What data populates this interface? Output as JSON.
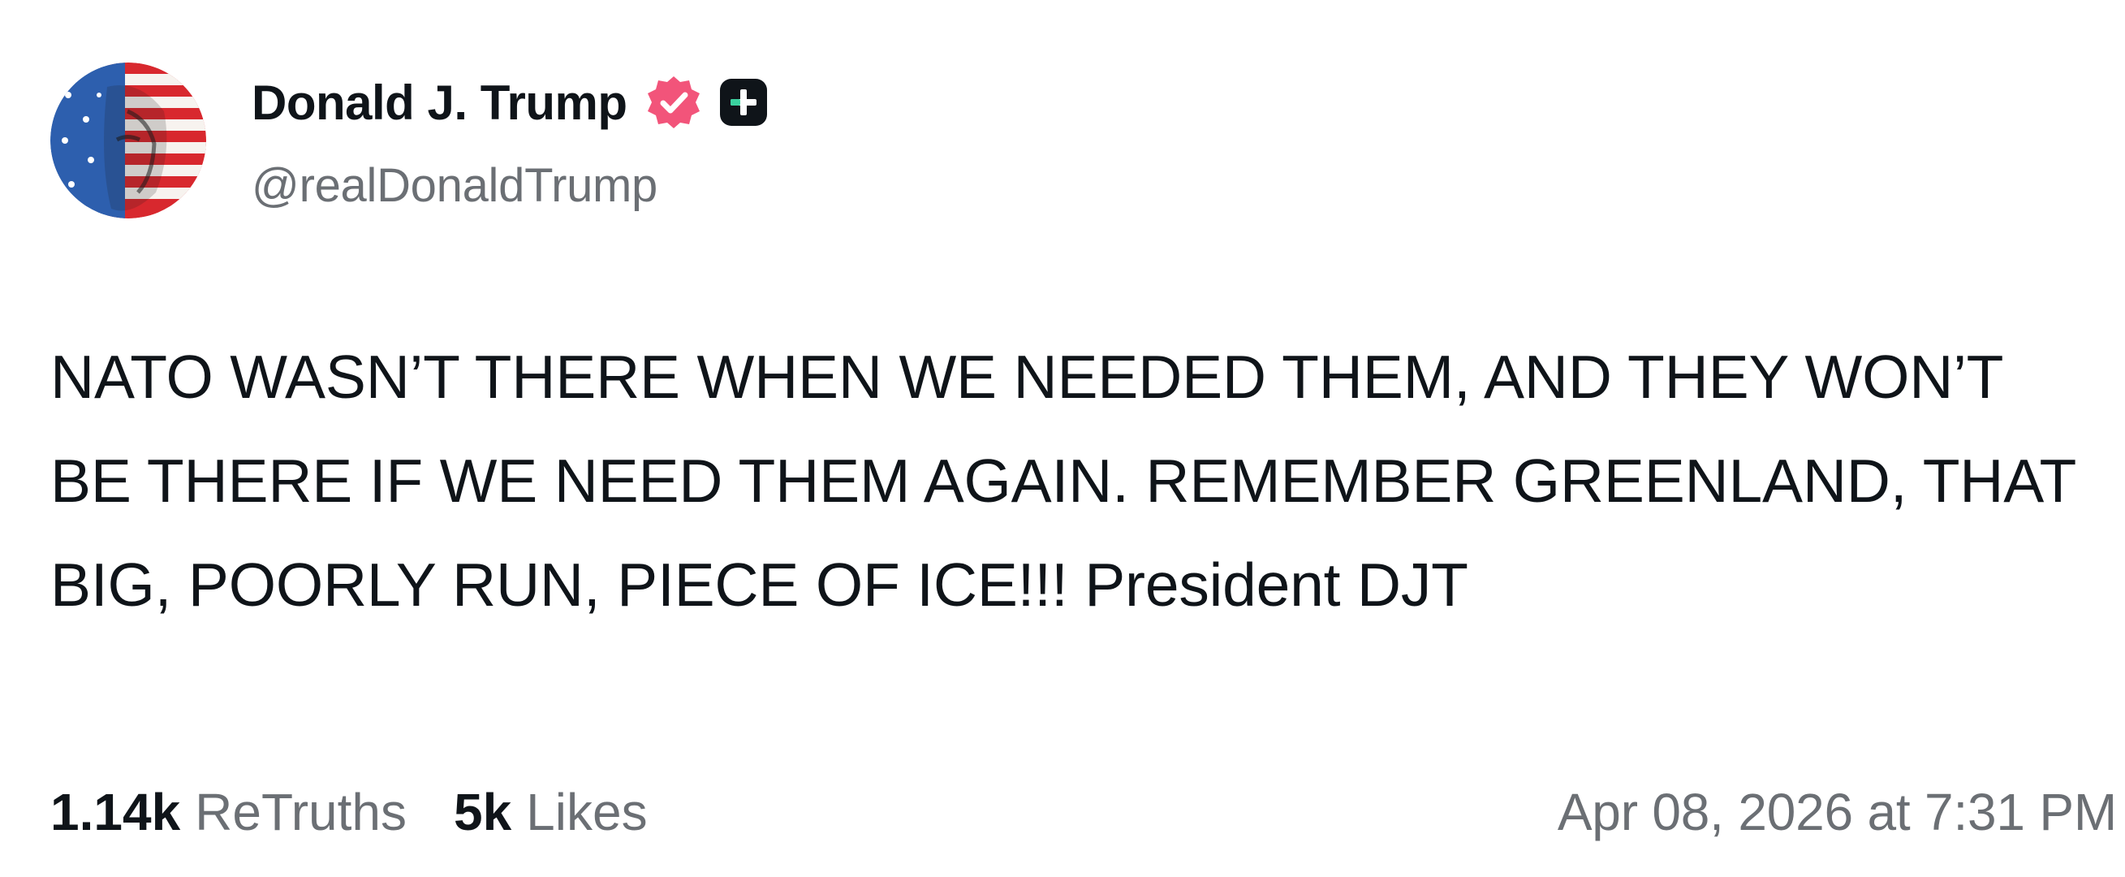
{
  "author": {
    "display_name": "Donald J. Trump",
    "handle": "@realDonaldTrump",
    "verified_icon": "verified-badge-icon",
    "plus_icon": "plus-badge-icon",
    "verified_color": "#f2547a"
  },
  "post": {
    "text": "NATO WASN’T THERE WHEN WE NEEDED THEM, AND THEY WON’T BE THERE IF WE NEED THEM AGAIN. REMEMBER GREENLAND, THAT BIG, POORLY RUN, PIECE OF ICE!!! President DJT"
  },
  "stats": {
    "retruths_count": "1.14k",
    "retruths_label": "ReTruths",
    "likes_count": "5k",
    "likes_label": "Likes"
  },
  "timestamp": "Apr 08, 2026 at 7:31 PM"
}
